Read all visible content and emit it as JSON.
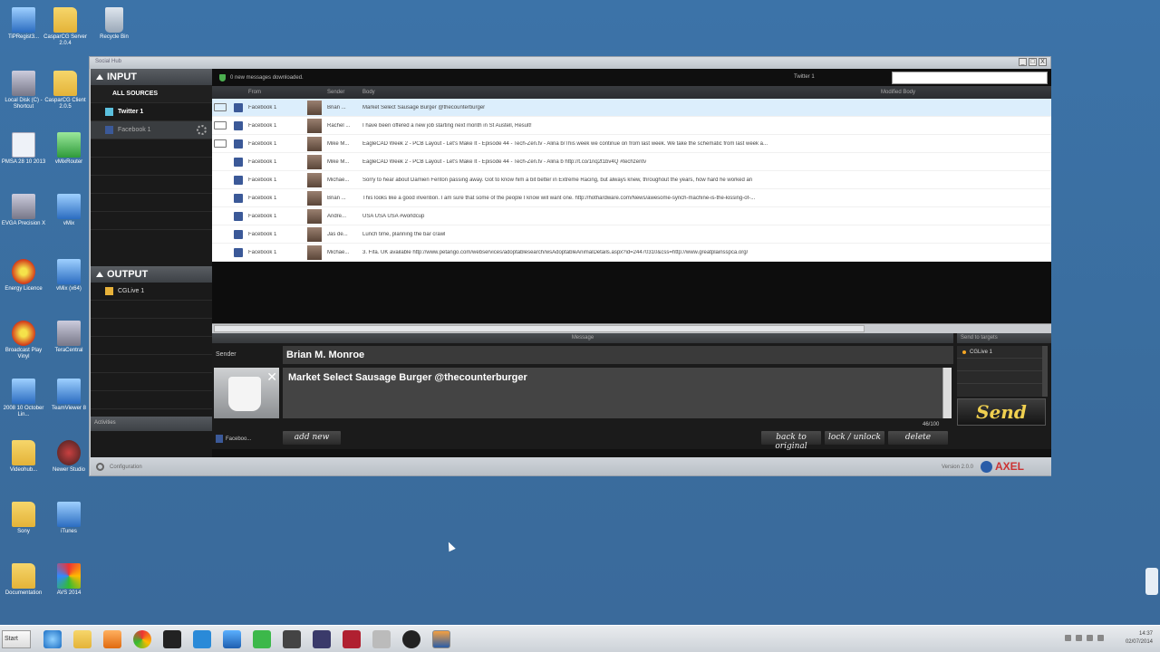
{
  "desktop": {
    "icons": [
      {
        "label": "TiPRegist3...",
        "kind": "app-blue"
      },
      {
        "label": "CasparCG Server 2.0.4",
        "kind": "folder"
      },
      {
        "label": "Recycle Bin",
        "kind": "bin"
      },
      {
        "label": "Local Disk (C) - Shortcut",
        "kind": "app-grey"
      },
      {
        "label": "CasparCG Client 2.0.5",
        "kind": "folder"
      },
      {
        "label": "PMSA 28 10 2013",
        "kind": "app-doc"
      },
      {
        "label": "vMixRouter",
        "kind": "app-green"
      },
      {
        "label": "EVGA Precision X",
        "kind": "app-grey"
      },
      {
        "label": "vMix",
        "kind": "app-blue"
      },
      {
        "label": "Energy Licence",
        "kind": "app-red"
      },
      {
        "label": "vMix (x64)",
        "kind": "app-blue"
      },
      {
        "label": "Broadcast Play Vinyl",
        "kind": "app-red"
      },
      {
        "label": "TeraCentral",
        "kind": "app-grey"
      },
      {
        "label": "2008 10 October Lin...",
        "kind": "app-blue"
      },
      {
        "label": "TeamViewer 8",
        "kind": "app-blue"
      },
      {
        "label": "Videohub...",
        "kind": "folder"
      },
      {
        "label": "Newer Studio",
        "kind": "app-dark"
      },
      {
        "label": "Sony",
        "kind": "folder"
      },
      {
        "label": "iTunes",
        "kind": "app-blue"
      },
      {
        "label": "Documentation",
        "kind": "folder"
      },
      {
        "label": "AVS 2014",
        "kind": "app-multi"
      }
    ]
  },
  "window": {
    "title": "Social Hub",
    "controls": [
      "_",
      "□",
      "X"
    ]
  },
  "input_panel": {
    "heading": "INPUT",
    "sources": [
      {
        "label": "ALL SOURCES"
      },
      {
        "label": "Twitter 1"
      },
      {
        "label": "Facebook 1"
      }
    ]
  },
  "output_panel": {
    "heading": "OUTPUT",
    "items": [
      {
        "label": "CGLive 1"
      }
    ]
  },
  "activities_label": "Activities",
  "status": {
    "message": "0 new messages downloaded.",
    "active_source": "Twitter 1",
    "search_value": ""
  },
  "columns": {
    "from": "From",
    "sender": "Sender",
    "body": "Body",
    "modified": "Modified Body"
  },
  "messages": [
    {
      "from": "Facebook 1",
      "sender": "Brian ...",
      "body": "Market Select Sausage Burger @thecounterburger"
    },
    {
      "from": "Facebook 1",
      "sender": "Rachel ...",
      "body": "I have been offered a new job starting next month in St Austell, Result!"
    },
    {
      "from": "Facebook 1",
      "sender": "Mike M...",
      "body": "EagleCAD Week 2 - PCB Layout - Let's Make It - Episode 44 - Tech-Zen.tv - Alina b/This week we continue on from last week. We take the schematic from last week a..."
    },
    {
      "from": "Facebook 1",
      "sender": "Mike M...",
      "body": "EagleCAD Week 2 - PCB Layout - Let's Make It - Episode 44 - Tech-Zen.tv - Alina b http://t.co/1nq2t1bv4Q #techzentv"
    },
    {
      "from": "Facebook 1",
      "sender": "Michae...",
      "body": "Sorry to hear about Damien Fenton passing away. Got to know him a bit better in Extreme Racing, but always knew, throughout the years, how hard he worked an"
    },
    {
      "from": "Facebook 1",
      "sender": "Brian ...",
      "body": "This looks like a good invention. I am sure that some of the people I know will want one. http://hothardware.com/News/awesome-synch-machine-is-the-kissing-of-..."
    },
    {
      "from": "Facebook 1",
      "sender": "Andre...",
      "body": "USA USA USA #worldcup"
    },
    {
      "from": "Facebook 1",
      "sender": "Jas de...",
      "body": "Lunch time, planning the bar crawl"
    },
    {
      "from": "Facebook 1",
      "sender": "Michae...",
      "body": "3. Fifa. UK available http://www.petango.com/webservices/adoptablesearch/wsAdoptableAnimalDetails.aspx?id=24470310&css=http://www.greatplainsspca.org/"
    }
  ],
  "editor": {
    "message_heading": "Message",
    "sender_label": "Sender",
    "sender_name": "Brian M. Monroe",
    "message_text": "Market Select Sausage Burger @thecounterburger",
    "char_count": "46/100",
    "source_label": "Faceboo...",
    "buttons": {
      "add_new": "add new",
      "back_original": "back to original",
      "lock_unlock": "lock / unlock",
      "delete": "delete"
    }
  },
  "targets": {
    "heading": "Send to targets",
    "items": [
      {
        "label": "CGLive 1"
      }
    ],
    "send_label": "Send"
  },
  "footer": {
    "configuration": "Configuration",
    "version": "Version 2.0.0",
    "logo": "AXEL"
  },
  "taskbar": {
    "start": "Start",
    "time": "14:37",
    "date": "02/07/2014"
  }
}
